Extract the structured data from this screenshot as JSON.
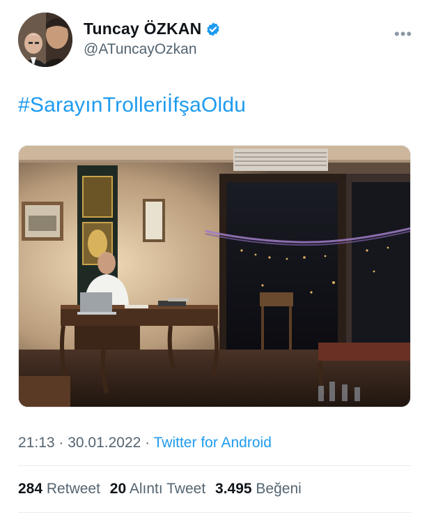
{
  "author": {
    "name": "Tuncay ÖZKAN",
    "handle": "@ATuncayOzkan",
    "verified_color": "#1d9bf0"
  },
  "tweet": {
    "hashtag": "#SarayınTrolleriİfşaOldu",
    "time": "21:13",
    "separator1": " · ",
    "date": "30.01.2022",
    "separator2": " · ",
    "source": "Twitter for Android"
  },
  "stats": {
    "retweets_count": "284",
    "retweets_label": "Retweet",
    "quotes_count": "20",
    "quotes_label": "Alıntı Tweet",
    "likes_count": "3.495",
    "likes_label": "Beğeni"
  },
  "icons": {
    "more": "more-options-icon",
    "verified": "verified-badge-icon"
  },
  "colors": {
    "link": "#1d9bf0",
    "secondary_text": "#536471",
    "primary_text": "#0f1419"
  }
}
